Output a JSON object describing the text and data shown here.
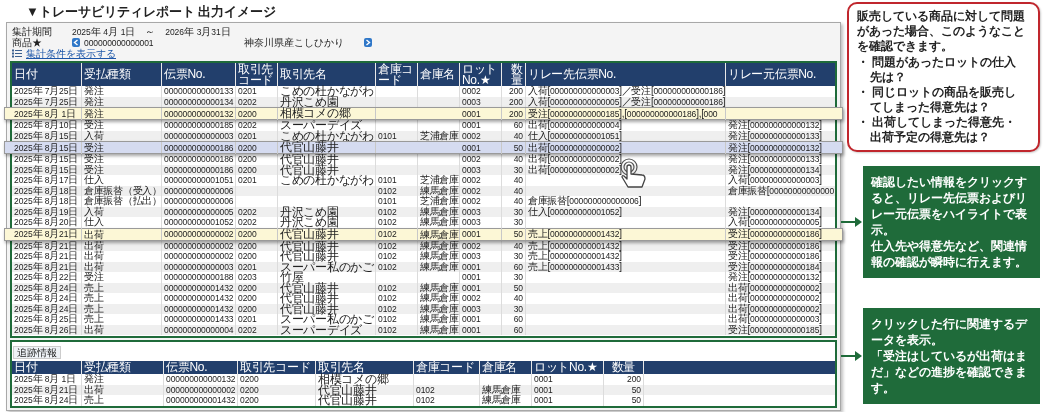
{
  "title": "▼トレーサビリティレポート 出力イメージ",
  "filter": {
    "period_label": "集計期間",
    "period_from": "2025年 4月 1日",
    "period_sep": "～",
    "period_to": "2026年 3月31日",
    "product_label": "商品★",
    "product_code": "000000000000001",
    "product_name": "神奈川県産こしひかり",
    "conditions_link": "集計条件を表示する"
  },
  "report_table": {
    "columns": [
      "日付",
      "受払種類",
      "伝票No.",
      "取引先コード",
      "取引先名",
      "倉庫コード",
      "倉庫名",
      "ロットNo.★",
      "数量",
      "リレー先伝票No.",
      "リレー元伝票No."
    ],
    "rows": [
      {
        "kind": "row",
        "cells": [
          "2025年 7月25日",
          "発注",
          "000000000000133",
          "0201",
          "こめの杜かながわ",
          null,
          null,
          "0002",
          "200",
          "入荷[000000000000003]／受注[000000000000186]",
          null
        ]
      },
      {
        "kind": "row",
        "cells": [
          "2025年 7月25日",
          "発注",
          "000000000000134",
          "0202",
          "丹沢こめ園",
          null,
          null,
          "0003",
          "200",
          "入荷[000000000000005]／受注[000000000000186]",
          null
        ]
      },
      {
        "kind": "highlight",
        "color": "#fcf7d6",
        "cells": [
          "2025年 8月 1日",
          "発注",
          "000000000000132",
          "0200",
          "相模コメの郷",
          null,
          null,
          "0001",
          "200",
          "受注[000000000000185],[000000000000186],[000",
          null
        ]
      },
      {
        "kind": "row",
        "cells": [
          "2025年 8月10日",
          "受注",
          "000000000000185",
          "0202",
          "スーパーデイズ",
          null,
          null,
          "0001",
          "60",
          "出荷[000000000000004]",
          "発注[000000000000132]"
        ]
      },
      {
        "kind": "row",
        "cells": [
          "2025年 8月15日",
          "入荷",
          "000000000000003",
          "0201",
          "こめの杜かながわ",
          "0101",
          "芝浦倉庫",
          "0002",
          "40",
          "仕入[000000000001051]",
          "発注[000000000000133]"
        ]
      },
      {
        "kind": "highlight",
        "color": "#d5dbf0",
        "cells": [
          "2025年 8月15日",
          "受注",
          "000000000000186",
          "0200",
          "代官山藤井",
          null,
          null,
          "0001",
          "50",
          "出荷[000000000000002]",
          "発注[000000000000132]"
        ]
      },
      {
        "kind": "row",
        "cells": [
          "2025年 8月15日",
          "受注",
          "000000000000186",
          "0200",
          "代官山藤井",
          null,
          null,
          "0002",
          "40",
          "出荷[000000000000002]",
          "発注[000000000000133]"
        ]
      },
      {
        "kind": "row",
        "cells": [
          "2025年 8月15日",
          "受注",
          "000000000000186",
          "0200",
          "代官山藤井",
          null,
          null,
          "0003",
          "30",
          "出荷[000000000000002]",
          "発注[000000000000134]"
        ]
      },
      {
        "kind": "row",
        "cells": [
          "2025年 8月17日",
          "仕入",
          "000000000001051",
          "0201",
          "こめの杜かながわ",
          "0101",
          "芝浦倉庫",
          "0002",
          "40",
          null,
          "入荷[000000000000003]"
        ]
      },
      {
        "kind": "row",
        "cells": [
          "2025年 8月18日",
          "倉庫振替（受入）",
          "000000000000006",
          null,
          null,
          "0102",
          "練馬倉庫",
          "0002",
          "40",
          null,
          "倉庫振替[00000000000000"
        ]
      },
      {
        "kind": "row",
        "cells": [
          "2025年 8月18日",
          "倉庫振替（払出）",
          "000000000000006",
          null,
          null,
          "0101",
          "芝浦倉庫",
          "0002",
          "40",
          "倉庫振替[000000000000006]",
          null
        ]
      },
      {
        "kind": "row",
        "cells": [
          "2025年 8月19日",
          "入荷",
          "000000000000005",
          "0202",
          "丹沢こめ園",
          "0102",
          "練馬倉庫",
          "0003",
          "30",
          "仕入[000000000001052]",
          "発注[000000000000134]"
        ]
      },
      {
        "kind": "row",
        "cells": [
          "2025年 8月20日",
          "仕入",
          "000000000001052",
          "0202",
          "丹沢こめ園",
          "0102",
          "練馬倉庫",
          "0003",
          "30",
          null,
          "入荷[000000000000005]"
        ]
      },
      {
        "kind": "highlight",
        "color": "#fcf7d6",
        "cells": [
          "2025年 8月21日",
          "出荷",
          "000000000000002",
          "0200",
          "代官山藤井",
          "0102",
          "練馬倉庫",
          "0001",
          "50",
          "売上[000000000001432]",
          "受注[000000000000186]"
        ]
      },
      {
        "kind": "row",
        "cells": [
          "2025年 8月21日",
          "出荷",
          "000000000000002",
          "0200",
          "代官山藤井",
          "0102",
          "練馬倉庫",
          "0002",
          "40",
          "売上[000000000001432]",
          "受注[000000000000186]"
        ]
      },
      {
        "kind": "row",
        "cells": [
          "2025年 8月21日",
          "出荷",
          "000000000000002",
          "0200",
          "代官山藤井",
          "0102",
          "練馬倉庫",
          "0003",
          "30",
          "売上[000000000001432]",
          "受注[000000000000186]"
        ]
      },
      {
        "kind": "row",
        "cells": [
          "2025年 8月21日",
          "出荷",
          "000000000000003",
          "0201",
          "スーパー私のかご",
          "0102",
          "練馬倉庫",
          "0001",
          "60",
          "売上[000000000001433]",
          "受注[000000000000184]"
        ]
      },
      {
        "kind": "row",
        "cells": [
          "2025年 8月22日",
          "受注",
          "000000000000188",
          "0203",
          "竹屋",
          null,
          null,
          "0001",
          "30",
          null,
          "発注[000000000000132]"
        ]
      },
      {
        "kind": "row",
        "cells": [
          "2025年 8月24日",
          "売上",
          "000000000001432",
          "0200",
          "代官山藤井",
          "0102",
          "練馬倉庫",
          "0001",
          "50",
          null,
          "出荷[000000000000002]"
        ]
      },
      {
        "kind": "row",
        "cells": [
          "2025年 8月24日",
          "売上",
          "000000000001432",
          "0200",
          "代官山藤井",
          "0102",
          "練馬倉庫",
          "0002",
          "40",
          null,
          "出荷[000000000000002]"
        ]
      },
      {
        "kind": "row",
        "cells": [
          "2025年 8月24日",
          "売上",
          "000000000001432",
          "0200",
          "代官山藤井",
          "0102",
          "練馬倉庫",
          "0003",
          "30",
          null,
          "出荷[000000000000002]"
        ]
      },
      {
        "kind": "row",
        "cells": [
          "2025年 8月25日",
          "売上",
          "000000000001433",
          "0201",
          "スーパー私のかご",
          "0102",
          "練馬倉庫",
          "0001",
          "60",
          null,
          "出荷[000000000000003]"
        ]
      },
      {
        "kind": "row",
        "cells": [
          "2025年 8月26日",
          "出荷",
          "000000000000004",
          "0202",
          "スーパーデイズ",
          "0102",
          "練馬倉庫",
          "0001",
          "60",
          null,
          "受注[000000000000185]"
        ]
      }
    ]
  },
  "progress": {
    "tab": "追跡情報",
    "columns": [
      "日付",
      "受払種類",
      "伝票No.",
      "取引先コード",
      "取引先名",
      "倉庫コード",
      "倉庫名",
      "ロットNo.★",
      "数量"
    ],
    "rows": [
      {
        "cells": [
          "2025年 8月 1日",
          "発注",
          "000000000000132",
          "0200",
          "相模コメの郷",
          null,
          null,
          "0001",
          "200"
        ]
      },
      {
        "cells": [
          "2025年 8月21日",
          "出荷",
          "000000000000002",
          "0200",
          "代官山藤井",
          "0102",
          "練馬倉庫",
          "0001",
          "50"
        ]
      },
      {
        "cells": [
          "2025年 8月24日",
          "売上",
          "000000000001432",
          "0200",
          "代官山藤井",
          "0102",
          "練馬倉庫",
          "0001",
          "50"
        ]
      }
    ]
  },
  "callouts": [
    {
      "kind": "bubble",
      "heading": "販売している商品に対して問題があった場合、このようなことを確認できます。",
      "bullets": [
        "・ 問題があったロットの仕入先は？",
        "・ 同じロットの商品を販売してしまった得意先は？",
        "・ 出荷してしまった得意先・出荷予定の得意先は？"
      ]
    },
    {
      "kind": "note",
      "paragraphs": [
        "確認したい情報をクリックすると、リレー先伝票およびリレー元伝票をハイライトで表示。",
        "仕入先や得意先など、関連情報の確認が瞬時に行えます。"
      ]
    },
    {
      "kind": "note",
      "paragraphs": [
        "クリックした行に関連するデータを表示。",
        "「受注はしているが出荷はまだ」などの進捗を確認できます。"
      ]
    }
  ]
}
